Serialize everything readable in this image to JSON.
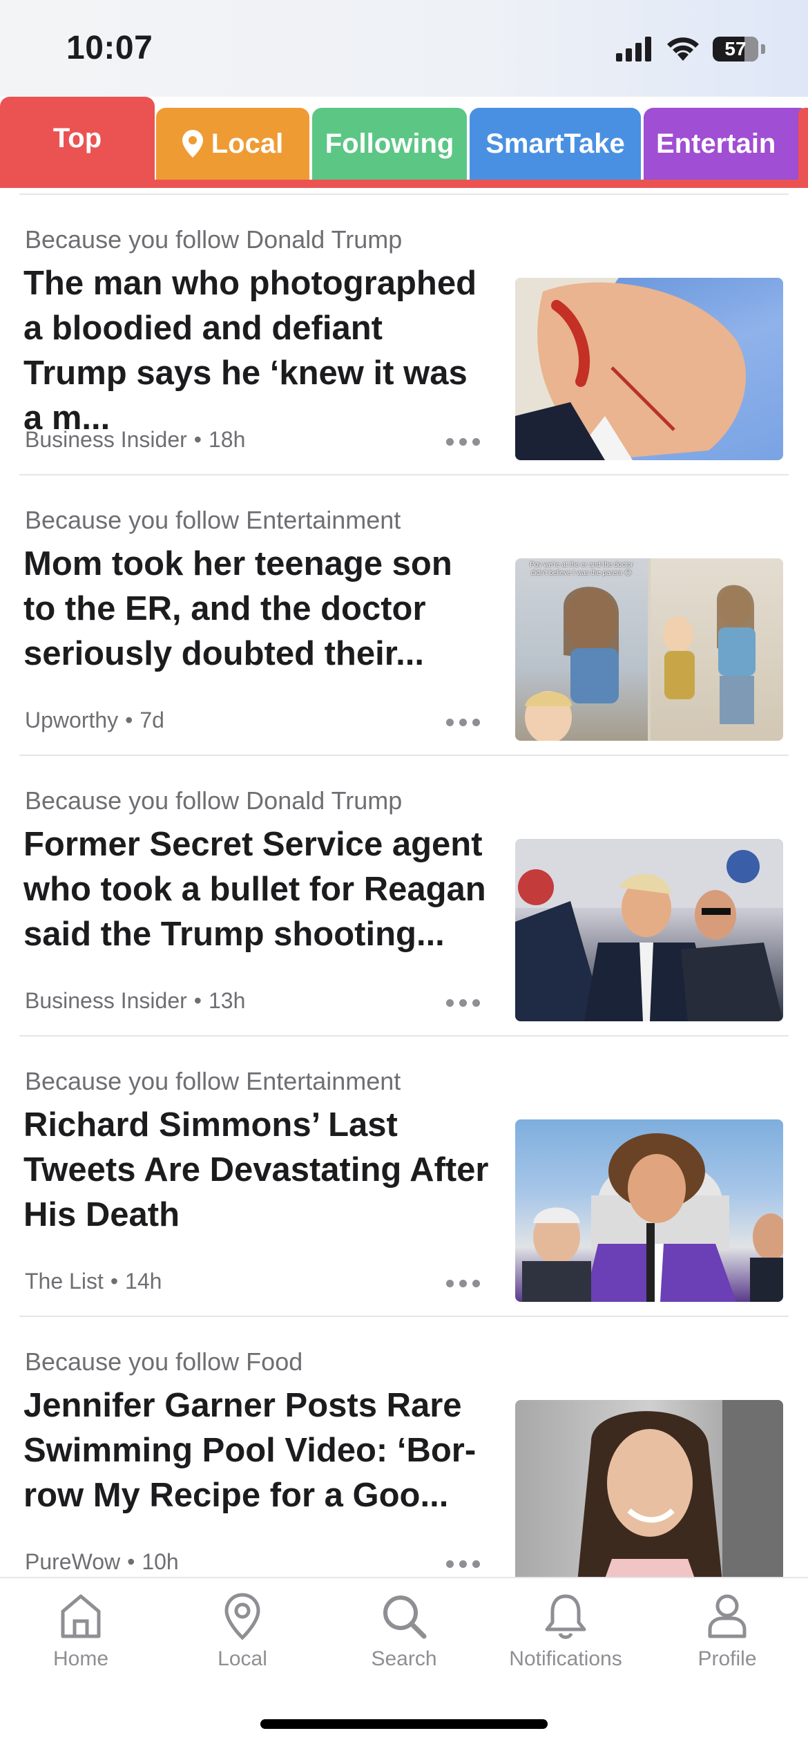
{
  "status_bar": {
    "time": "10:07",
    "battery": "57"
  },
  "tabs": [
    {
      "label": "Top",
      "color": "#eb5352"
    },
    {
      "label": "Local",
      "color": "#ef9b34"
    },
    {
      "label": "Following",
      "color": "#5cc685"
    },
    {
      "label": "SmartTake",
      "color": "#4a90e2"
    },
    {
      "label": "Entertain",
      "color": "#a04ed3"
    }
  ],
  "articles": [
    {
      "reason": "Because you follow Donald Trump",
      "headline": "The man who photographed a bloodied and defiant Trump says he ‘knew it was a m...",
      "source": "Business Insider",
      "age": "18h",
      "thumbnail": "trump-face-photo"
    },
    {
      "reason": "Because you follow Entertainment",
      "headline": "Mom took her teenage son to the ER, and the doctor seriously doubted their...",
      "source": "Upworthy",
      "age": "7d",
      "thumbnail": "mom-and-children-photo",
      "thumbnail_caption": "Pov we're at the er and the doctor didn't believe I was the parent 😂"
    },
    {
      "reason": "Because you follow Donald Trump",
      "headline": "Former Secret Service agent who took a bullet for Reagan said the Trump shooting...",
      "source": "Business Insider",
      "age": "13h",
      "thumbnail": "rally-shooting-photo"
    },
    {
      "reason": "Because you follow Entertainment",
      "headline": "Richard Simmons’ Last Tweets Are Devastating After His Death",
      "source": "The List",
      "age": "14h",
      "thumbnail": "simmons-capitol-photo"
    },
    {
      "reason": "Because you follow Food",
      "headline": "Jennifer Garner Posts Rare Swimming Pool Video: ‘Bor-row My Recipe for a Goo...",
      "source": "PureWow",
      "age": "10h",
      "thumbnail": "garner-portrait-photo"
    }
  ],
  "bottom_nav": [
    {
      "label": "Home",
      "icon": "home-icon"
    },
    {
      "label": "Local",
      "icon": "location-pin-icon"
    },
    {
      "label": "Search",
      "icon": "search-icon"
    },
    {
      "label": "Notifications",
      "icon": "bell-icon"
    },
    {
      "label": "Profile",
      "icon": "person-icon"
    }
  ]
}
